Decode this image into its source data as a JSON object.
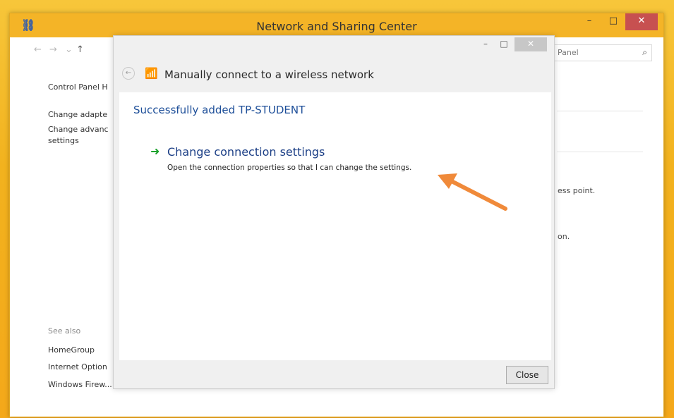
{
  "main_window": {
    "title": "Network and Sharing Center",
    "search_placeholder": "Panel",
    "left_pane": {
      "control_panel_home": "Control Panel H",
      "change_adapter": "Change adapte",
      "change_advanced": "Change advanc",
      "settings": "settings",
      "see_also": "See also",
      "homegroup": "HomeGroup",
      "internet_options": "Internet Option",
      "windows_firewall": "Windows Firew..."
    },
    "right_text": {
      "line1": "ess point.",
      "line2": "on."
    },
    "controls": {
      "minimize": "–",
      "maximize": "□",
      "close": "✕"
    }
  },
  "dialog": {
    "title": "Manually connect to a wireless network",
    "success_message": "Successfully added TP-STUDENT",
    "link_title": "Change connection settings",
    "link_description": "Open the connection properties so that I can change the settings.",
    "close_button": "Close",
    "controls": {
      "minimize": "–",
      "maximize": "□",
      "close": "✕"
    }
  },
  "colors": {
    "desktop": "#f2b21e",
    "annotation_arrow": "#f08a3a",
    "link_blue": "#1c3f86",
    "success_blue": "#1e4f99",
    "green_arrow": "#1ba12c"
  },
  "icons": {
    "app": "network-icon",
    "wifi": "wifi-icon",
    "link_arrow": "green-arrow-icon",
    "search": "search-icon"
  }
}
